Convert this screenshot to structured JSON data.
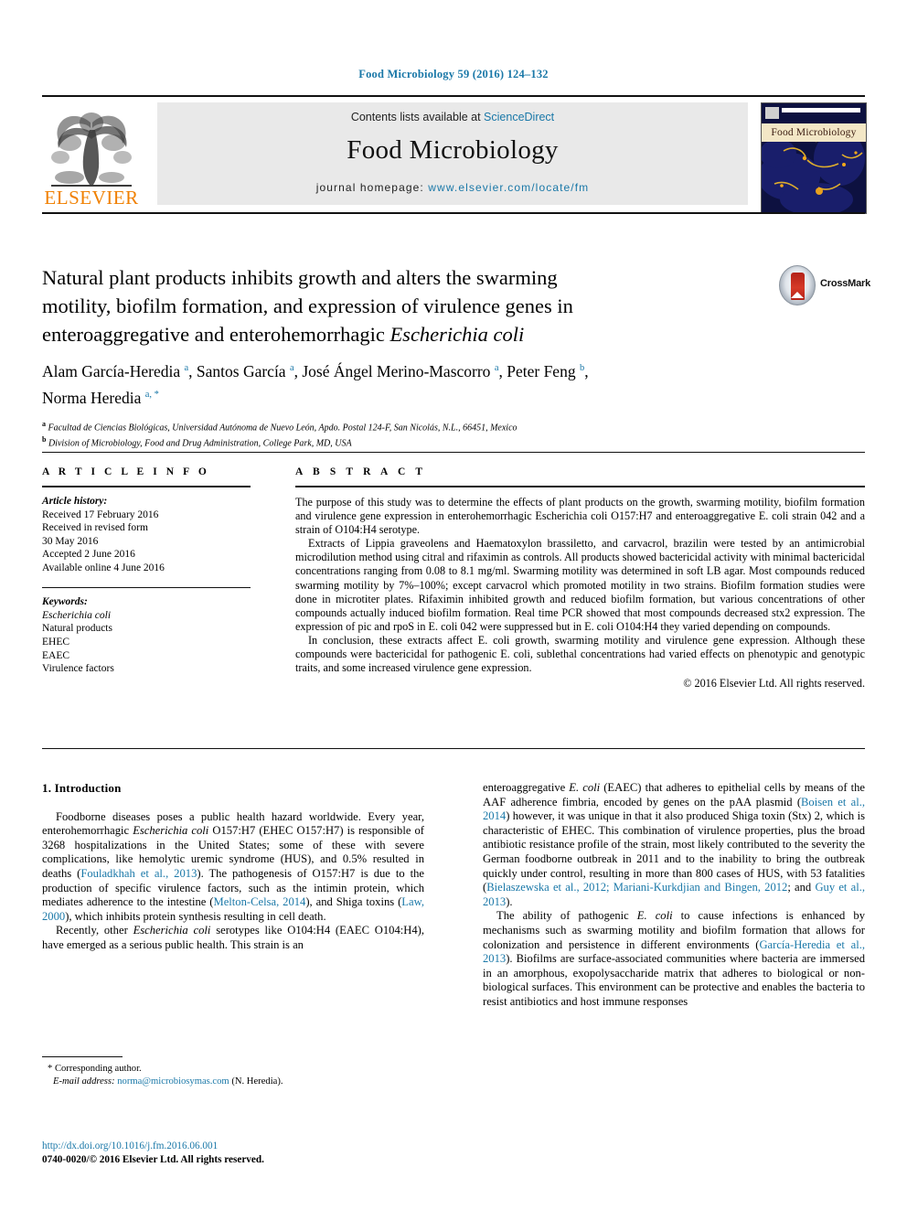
{
  "running_head": "Food Microbiology 59 (2016) 124–132",
  "masthead": {
    "publisher_logo_text": "ELSEVIER",
    "contents_line_prefix": "Contents lists available at ",
    "contents_line_link": "ScienceDirect",
    "journal_title": "Food Microbiology",
    "homepage_prefix": "journal homepage: ",
    "homepage_link": "www.elsevier.com/locate/fm",
    "cover_caption": "Food Microbiology"
  },
  "article": {
    "title_line1": "Natural plant products inhibits growth and alters the swarming",
    "title_line2": "motility, biofilm formation, and expression of virulence genes in",
    "title_line3_a": "enteroaggregative and enterohemorrhagic ",
    "title_line3_italic": "Escherichia coli",
    "crossmark_label": "CrossMark",
    "authors_line1": "Alam García-Heredia <a>, Santos García <a>, José Ángel Merino-Mascorro <a>, Peter Feng <b>,",
    "authors_line2": "Norma Heredia <a, *>",
    "affiliation_a": "Facultad de Ciencias Biológicas, Universidad Autónoma de Nuevo León, Apdo. Postal 124-F, San Nicolás, N.L., 66451, Mexico",
    "affiliation_b": "Division of Microbiology, Food and Drug Administration, College Park, MD, USA"
  },
  "article_info": {
    "heading": "A R T I C L E   I N F O",
    "history_title": "Article history:",
    "history": [
      "Received 17 February 2016",
      "Received in revised form",
      "30 May 2016",
      "Accepted 2 June 2016",
      "Available online 4 June 2016"
    ],
    "keywords_title": "Keywords:",
    "keywords": [
      "Escherichia coli",
      "Natural products",
      "EHEC",
      "EAEC",
      "Virulence factors"
    ]
  },
  "abstract": {
    "heading": "A B S T R A C T",
    "p1": "The purpose of this study was to determine the effects of plant products on the growth, swarming motility, biofilm formation and virulence gene expression in enterohemorrhagic Escherichia coli O157:H7 and enteroaggregative E. coli strain 042 and a strain of O104:H4 serotype.",
    "p2": "Extracts of Lippia graveolens and Haematoxylon brassiletto, and carvacrol, brazilin were tested by an antimicrobial microdilution method using citral and rifaximin as controls. All products showed bactericidal activity with minimal bactericidal concentrations ranging from 0.08 to 8.1 mg/ml. Swarming motility was determined in soft LB agar. Most compounds reduced swarming motility by 7%–100%; except carvacrol which promoted motility in two strains. Biofilm formation studies were done in microtiter plates. Rifaximin inhibited growth and reduced biofilm formation, but various concentrations of other compounds actually induced biofilm formation. Real time PCR showed that most compounds decreased stx2 expression. The expression of pic and rpoS in E. coli 042 were suppressed but in E. coli O104:H4 they varied depending on compounds.",
    "p3": "In conclusion, these extracts affect E. coli growth, swarming motility and virulence gene expression. Although these compounds were bactericidal for pathogenic E. coli, sublethal concentrations had varied effects on phenotypic and genotypic traits, and some increased virulence gene expression.",
    "copyright": "© 2016 Elsevier Ltd. All rights reserved."
  },
  "body": {
    "section_heading": "1. Introduction",
    "left_p1": "Foodborne diseases poses a public health hazard worldwide. Every year, enterohemorrhagic Escherichia coli O157:H7 (EHEC O157:H7) is responsible of 3268 hospitalizations in the United States; some of these with severe complications, like hemolytic uremic syndrome (HUS), and 0.5% resulted in deaths (Fouladkhah et al., 2013). The pathogenesis of O157:H7 is due to the production of specific virulence factors, such as the intimin protein, which mediates adherence to the intestine (Melton-Celsa, 2014), and Shiga toxins (Law, 2000), which inhibits protein synthesis resulting in cell death.",
    "left_p2": "Recently, other Escherichia coli serotypes like O104:H4 (EAEC O104:H4), have emerged as a serious public health. This strain is an",
    "right_p1": "enteroaggregative E. coli (EAEC) that adheres to epithelial cells by means of the AAF adherence fimbria, encoded by genes on the pAA plasmid (Boisen et al., 2014) however, it was unique in that it also produced Shiga toxin (Stx) 2, which is characteristic of EHEC. This combination of virulence properties, plus the broad antibiotic resistance profile of the strain, most likely contributed to the severity the German foodborne outbreak in 2011 and to the inability to bring the outbreak quickly under control, resulting in more than 800 cases of HUS, with 53 fatalities (Bielaszewska et al., 2012; Mariani-Kurkdjian and Bingen, 2012; and Guy et al., 2013).",
    "right_p2": "The ability of pathogenic E. coli to cause infections is enhanced by mechanisms such as swarming motility and biofilm formation that allows for colonization and persistence in different environments (García-Heredia et al., 2013). Biofilms are surface-associated communities where bacteria are immersed in an amorphous, exopolysaccharide matrix that adheres to biological or non-biological surfaces. This environment can be protective and enables the bacteria to resist antibiotics and host immune responses"
  },
  "footnotes": {
    "corresponding": "* Corresponding author.",
    "email_label": "E-mail address: ",
    "email": "norma@microbiosymas.com",
    "email_suffix": " (N. Heredia)."
  },
  "footer": {
    "doi": "http://dx.doi.org/10.1016/j.fm.2016.06.001",
    "issn_line": "0740-0020/© 2016 Elsevier Ltd. All rights reserved."
  },
  "colors": {
    "link": "#1a78a8",
    "elsevier_orange": "#f08000",
    "rule": "#111111",
    "panel": "#e9e9e9"
  }
}
